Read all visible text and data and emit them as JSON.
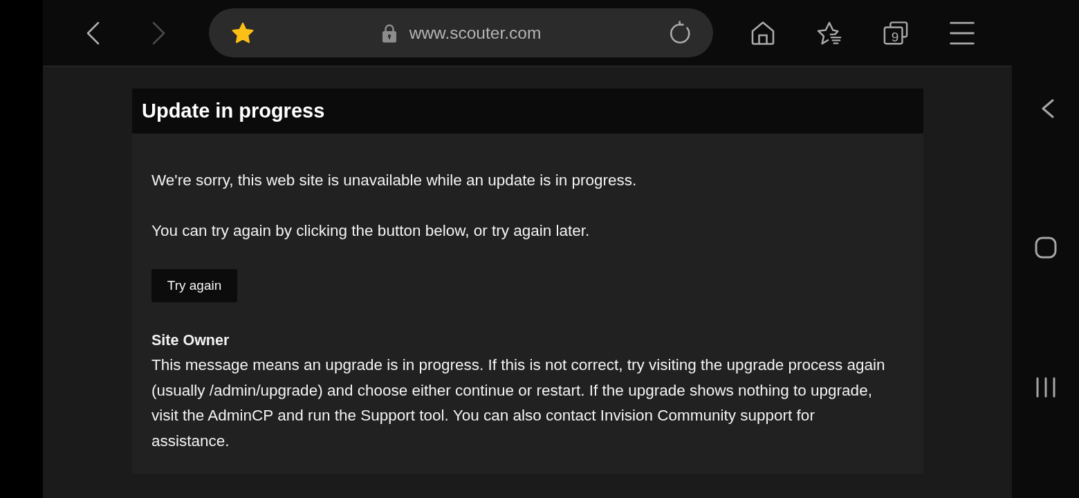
{
  "toolbar": {
    "back": {
      "disabled": false
    },
    "forward": {
      "disabled": true
    },
    "address_bar": {
      "bookmarked": true,
      "url": "www.scouter.com"
    },
    "tab_count": "9"
  },
  "card": {
    "title": "Update in progress",
    "paragraphs": [
      "We're sorry, this web site is unavailable while an update is in progress.",
      "You can try again by clicking the button below, or try again later."
    ],
    "button": "Try again",
    "owner_heading": "Site Owner",
    "owner_text": "This message means an upgrade is in progress. If this is not correct, try visiting the upgrade process again (usually /admin/upgrade) and choose either continue or restart. If the upgrade shows nothing to upgrade, visit the AdminCP and run the Support tool. You can also contact Invision Community support for assistance."
  }
}
